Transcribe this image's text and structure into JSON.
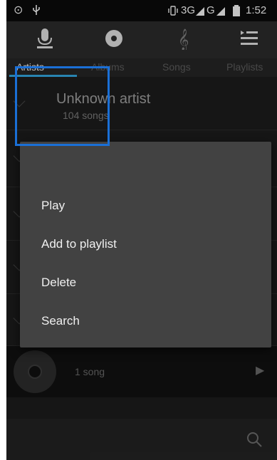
{
  "status_bar": {
    "network": "3G",
    "signal2": "G",
    "time": "1:52"
  },
  "tabs": [
    {
      "label": "Artists",
      "icon": "microphone-icon",
      "active": true
    },
    {
      "label": "Albums",
      "icon": "disc-icon",
      "active": false
    },
    {
      "label": "Songs",
      "icon": "treble-clef-icon",
      "active": false
    },
    {
      "label": "Playlists",
      "icon": "playlist-icon",
      "active": false
    }
  ],
  "artist": {
    "name": "Unknown artist",
    "count": "104 songs"
  },
  "song_row": {
    "count": "1 song"
  },
  "menu": {
    "items": [
      "Play",
      "Add to playlist",
      "Delete",
      "Search"
    ]
  },
  "colors": {
    "accent": "#31a2d8",
    "highlight": "#1a6fd6"
  }
}
